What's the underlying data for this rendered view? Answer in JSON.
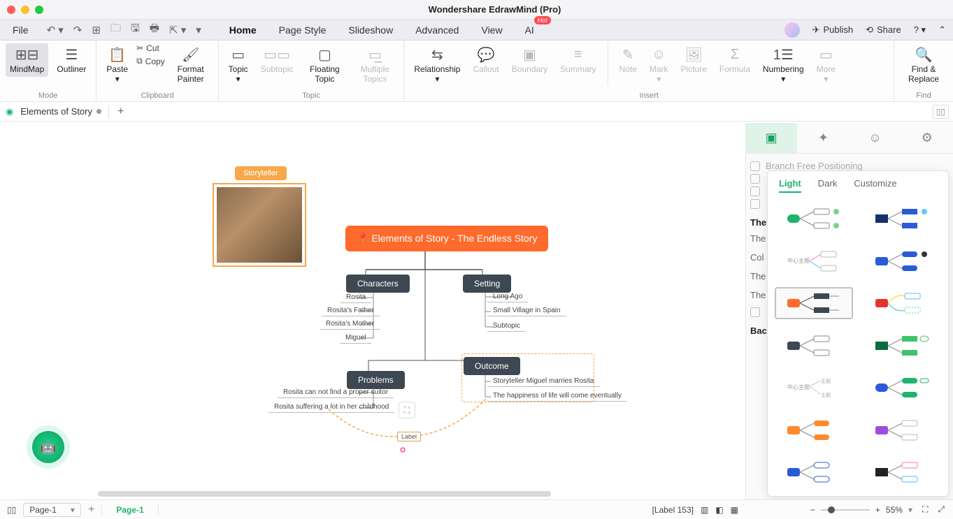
{
  "title": "Wondershare EdrawMind (Pro)",
  "menubar": {
    "file": "File",
    "tabs": [
      "Home",
      "Page Style",
      "Slideshow",
      "Advanced",
      "View",
      "AI"
    ],
    "active": "Home",
    "publish": "Publish",
    "share": "Share"
  },
  "ribbon": {
    "mode": {
      "label": "Mode",
      "items": [
        {
          "l": "MindMap",
          "sel": true
        },
        {
          "l": "Outliner"
        }
      ]
    },
    "clipboard": {
      "label": "Clipboard",
      "paste": "Paste",
      "cut": "Cut",
      "copy": "Copy",
      "fmt": "Format Painter"
    },
    "topic": {
      "label": "Topic",
      "items": [
        {
          "l": "Topic"
        },
        {
          "l": "Subtopic",
          "dis": true
        },
        {
          "l": "Floating Topic"
        },
        {
          "l": "Multiple Topics",
          "dis": true
        }
      ]
    },
    "insert": {
      "label": "Insert",
      "items": [
        {
          "l": "Relationship"
        },
        {
          "l": "Callout",
          "dis": true
        },
        {
          "l": "Boundary",
          "dis": true
        },
        {
          "l": "Summary",
          "dis": true
        },
        {
          "l": "Note",
          "dis": true
        },
        {
          "l": "Mark",
          "dis": true
        },
        {
          "l": "Picture",
          "dis": true
        },
        {
          "l": "Formula",
          "dis": true
        },
        {
          "l": "Numbering"
        },
        {
          "l": "More",
          "dis": true
        }
      ]
    },
    "find": {
      "label": "Find",
      "btn": "Find & Replace"
    }
  },
  "doc": {
    "tab": "Elements of Story"
  },
  "map": {
    "storyteller": "Storyteller",
    "central": "📍 Elements of Story - The Endless Story",
    "characters": "Characters",
    "setting": "Setting",
    "problems": "Problems",
    "outcome": "Outcome",
    "c_subs": [
      "Rosita",
      "Rosita's Father",
      "Rosita's Mother",
      "Miguel"
    ],
    "s_subs": [
      "Long Ago",
      "Small Village in Spain",
      "Subtopic"
    ],
    "p_subs": [
      "Rosita can not find a proper suitor",
      "Rosita suffering a lot in her childhood"
    ],
    "o_subs": [
      "Storyteller Miguel marries Rosita",
      "The happiness of life will come eventually"
    ],
    "label": "Label"
  },
  "rp": {
    "branchfree": "Branch Free Positioning",
    "theme_head": "The",
    "theme": "The",
    "col": "Col",
    "the2": "The",
    "the3": "The",
    "back": "Bac"
  },
  "theme_popup": {
    "tabs": [
      "Light",
      "Dark",
      "Customize"
    ],
    "active": "Light"
  },
  "status": {
    "label_info": "[Label 153]",
    "page": "Page-1",
    "pagetab": "Page-1",
    "zoom": "55%"
  }
}
